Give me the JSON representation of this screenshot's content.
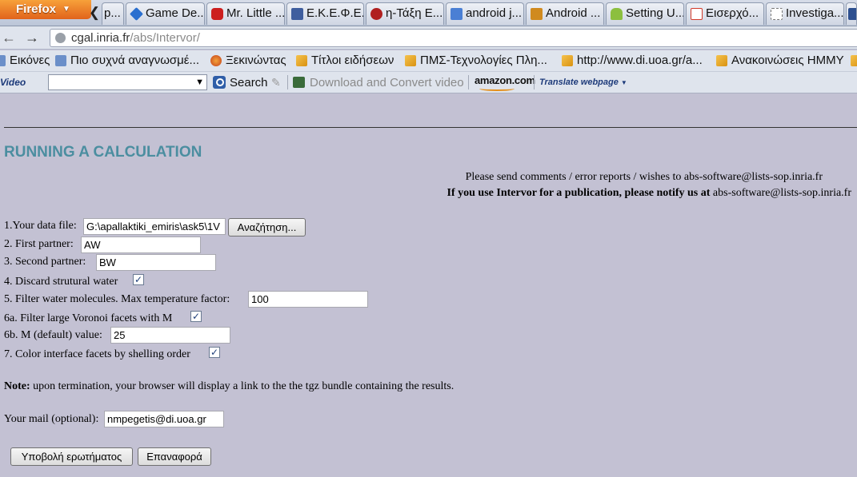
{
  "browser": {
    "menu_label": "Firefox",
    "tab_scroll_glyph": "❮",
    "tabs": [
      {
        "label": "p...",
        "color": "#3b5ea6"
      },
      {
        "label": "Game De...",
        "color": "#2a6fcf"
      },
      {
        "label": "Mr. Little ...",
        "color": "#cc1f1f"
      },
      {
        "label": "Ε.Κ.Ε.Φ.Ε....",
        "color": "#3f5e9e"
      },
      {
        "label": "η-Τάξη Ε...",
        "color": "#b02020"
      },
      {
        "label": "android j...",
        "color": "#4a7fd4"
      },
      {
        "label": "Android ...",
        "color": "#d08a1f"
      },
      {
        "label": "Setting U...",
        "color": "#8cbf3f"
      },
      {
        "label": "Εισερχό...",
        "color": "#d23a2a"
      },
      {
        "label": "Investiga...",
        "color": "#ffffff"
      }
    ],
    "url_domain": "cgal.inria.fr",
    "url_path": "/abs/Intervor/",
    "bookmarks": [
      "Εικόνες",
      "Πιο συχνά αναγνωσμέ...",
      "Ξεκινώντας",
      "Τίτλοι ειδήσεων",
      "ΠΜΣ-Τεχνολογίες Πλη...",
      "http://www.di.uoa.gr/a...",
      "Ανακοινώσεις ΗΜΜΥ"
    ],
    "toolbar": {
      "video_label": "Video",
      "search_label": "Search",
      "download_label": "Download and Convert video",
      "amazon_label": "amazon.com",
      "translate_label": "Translate webpage"
    }
  },
  "page": {
    "title": "RUNNING A CALCULATION",
    "contact_line1": "Please send comments / error reports / wishes to abs-software@lists-sop.inria.fr",
    "contact_line2_bold": "If you use Intervor for a publication, please notify us at",
    "contact_line2_email": "abs-software@lists-sop.inria.fr",
    "fields": {
      "data_file_label": "1.Your data file:",
      "data_file_value": "G:\\apallaktiki_emiris\\ask5\\1V",
      "browse_button": "Αναζήτηση...",
      "first_partner_label": "2. First partner:",
      "first_partner_value": "AW",
      "second_partner_label": "3. Second partner:",
      "second_partner_value": "BW",
      "discard_water_label": "4. Discard strutural water",
      "filter_water_label": "5. Filter water molecules. Max temperature factor:",
      "filter_water_value": "100",
      "filter_voronoi_label": "6a. Filter large Voronoi facets with M",
      "m_value_label": "6b. M (default) value:",
      "m_value": "25",
      "color_facets_label": "7. Color interface facets by shelling order",
      "checkmark": "✓"
    },
    "note_bold": "Note:",
    "note_text": "upon termination, your browser will display a link to the the tgz bundle containing the results.",
    "mail_label": "Your mail (optional):",
    "mail_value": "nmpegetis@di.uoa.gr",
    "submit_button": "Υποβολή ερωτήματος",
    "reset_button": "Επαναφορά"
  }
}
